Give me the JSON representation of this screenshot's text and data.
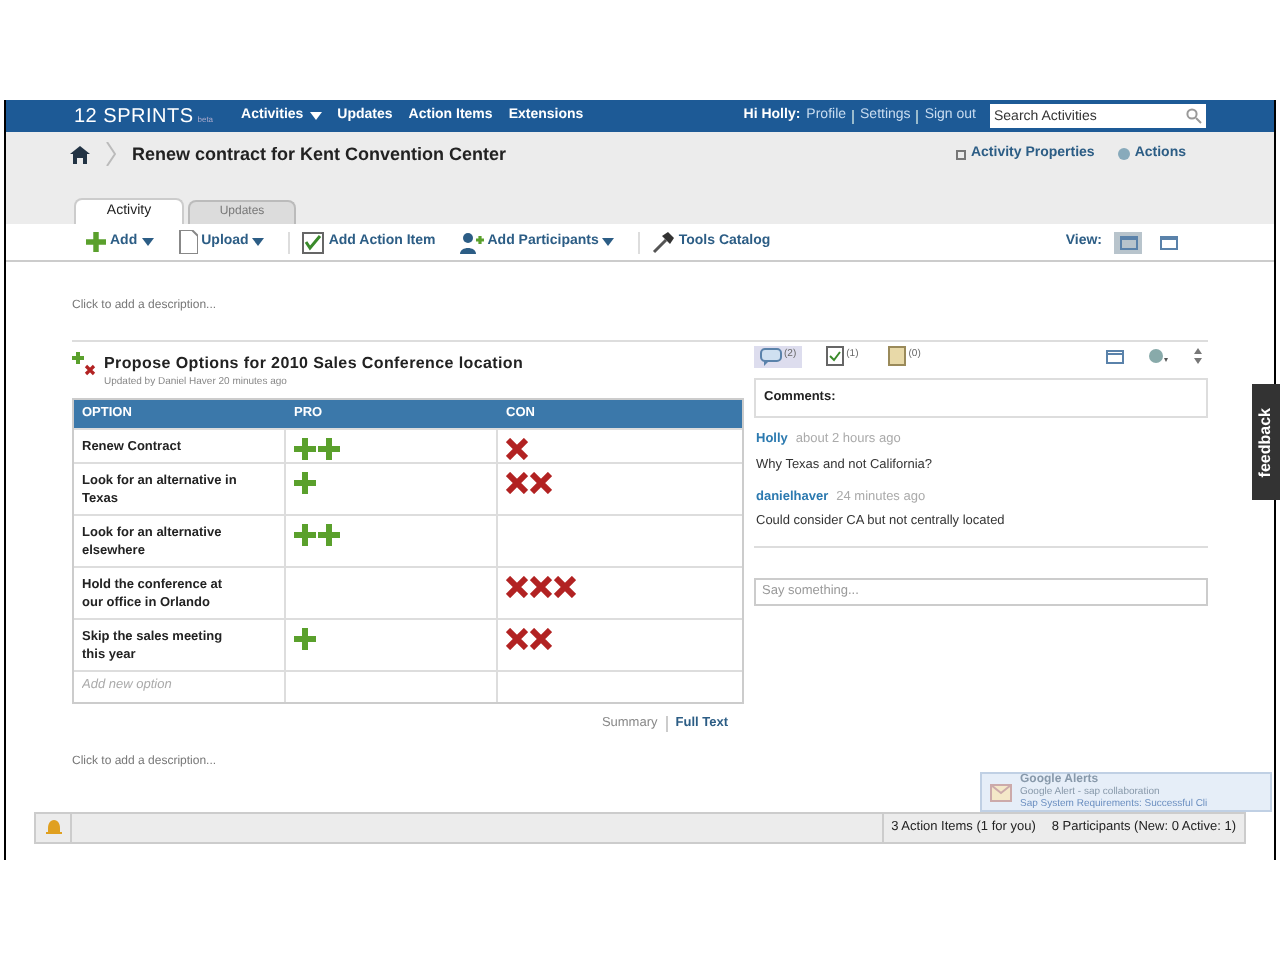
{
  "topbar": {
    "logo": "12 SPRINTS",
    "logo_suffix": "beta",
    "menu": [
      {
        "label": "Activities",
        "dropdown": true
      },
      {
        "label": "Updates",
        "dropdown": false
      },
      {
        "label": "Action Items",
        "dropdown": false
      },
      {
        "label": "Extensions",
        "dropdown": false
      }
    ],
    "greeting": "Hi Holly:",
    "links": [
      "Profile",
      "Settings",
      "Sign out"
    ],
    "search": {
      "placeholder": "Search Activities"
    }
  },
  "header": {
    "title": "Renew contract for Kent Convention Center",
    "actions": [
      "Activity Properties",
      "Actions"
    ]
  },
  "tabs": [
    {
      "label": "Activity",
      "selected": true
    },
    {
      "label": "Updates",
      "selected": false
    }
  ],
  "toolbar": {
    "items": [
      {
        "label": "Add",
        "kind": "add",
        "dropdown": true
      },
      {
        "label": "Upload",
        "kind": "upload",
        "dropdown": true
      },
      {
        "label": "Add Action Item",
        "kind": "action",
        "dropdown": false
      },
      {
        "label": "Add Participants",
        "kind": "people",
        "dropdown": true
      },
      {
        "label": "Tools Catalog",
        "kind": "tools",
        "dropdown": false
      }
    ],
    "view_label": "View:",
    "views": [
      {
        "selected": true
      },
      {
        "selected": false
      }
    ]
  },
  "description_top": "Click to add a description...",
  "tool": {
    "title": "Propose Options for 2010 Sales Conference location",
    "subtitle": "Updated by Daniel Haver 20 minutes ago",
    "columns": [
      "OPTION",
      "PRO",
      "CON"
    ],
    "rows": [
      {
        "option": "Renew Contract",
        "pro": [
          {
            "kind": "plus"
          },
          {
            "kind": "plus"
          }
        ],
        "con": [
          {
            "kind": "cross"
          }
        ]
      },
      {
        "option": "Look for an alternative in Texas",
        "pro": [
          {
            "kind": "plus"
          }
        ],
        "con": [
          {
            "kind": "cross"
          },
          {
            "kind": "cross"
          }
        ]
      },
      {
        "option": "Look for an alternative elsewhere",
        "pro": [
          {
            "kind": "plus"
          },
          {
            "kind": "plus"
          }
        ],
        "con": []
      },
      {
        "option": "Hold the conference at our office in Orlando",
        "pro": [],
        "con": [
          {
            "kind": "cross"
          },
          {
            "kind": "cross"
          },
          {
            "kind": "cross"
          }
        ]
      },
      {
        "option": "Skip the sales meeting this year",
        "pro": [
          {
            "kind": "plus"
          }
        ],
        "con": [
          {
            "kind": "cross"
          },
          {
            "kind": "cross"
          }
        ]
      }
    ],
    "new_option_placeholder": "Add new option",
    "views": [
      {
        "label": "Summary",
        "selected": true
      },
      {
        "label": "Full Text",
        "selected": false
      }
    ]
  },
  "side": {
    "tabs": [
      {
        "count": "(2)",
        "kind": "comments",
        "selected": true
      },
      {
        "count": "(1)",
        "kind": "tasks",
        "selected": false
      },
      {
        "count": "(0)",
        "kind": "files",
        "selected": false
      }
    ],
    "heading": "Comments:",
    "comments": [
      {
        "author": "Holly",
        "time": "about 2 hours ago",
        "text": "Why Texas and not California?"
      },
      {
        "author": "danielhaver",
        "time": "24 minutes ago",
        "text": "Could consider CA but not centrally located"
      }
    ],
    "input": {
      "placeholder": "Say something..."
    }
  },
  "feedback": "feedback",
  "description_bottom": "Click to add a description...",
  "status_bar": {
    "action_items": "3 Action Items (1 for you)",
    "participants": "8 Participants (New: 0 Active: 1)"
  },
  "notification": {
    "title": "Google Alerts",
    "line_1": "Google Alert - sap collaboration",
    "line_2": "Sap System Requirements: Successful Cli"
  }
}
